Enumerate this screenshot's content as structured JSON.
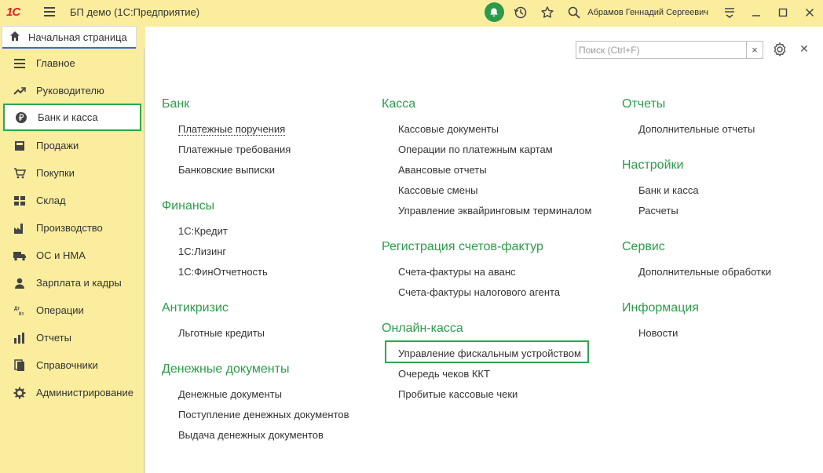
{
  "app": {
    "logo_text": "1С",
    "title": "БП демо  (1С:Предприятие)",
    "user_name": "Абрамов Геннадий Сергеевич"
  },
  "home_tab": {
    "label": "Начальная страница"
  },
  "sidebar": {
    "items": [
      {
        "label": "Главное",
        "icon": "list-icon"
      },
      {
        "label": "Руководителю",
        "icon": "trend-icon"
      },
      {
        "label": "Банк и касса",
        "icon": "ruble-icon"
      },
      {
        "label": "Продажи",
        "icon": "sales-icon"
      },
      {
        "label": "Покупки",
        "icon": "cart-icon"
      },
      {
        "label": "Склад",
        "icon": "warehouse-icon"
      },
      {
        "label": "Производство",
        "icon": "factory-icon"
      },
      {
        "label": "ОС и НМА",
        "icon": "truck-icon"
      },
      {
        "label": "Зарплата и кадры",
        "icon": "person-icon"
      },
      {
        "label": "Операции",
        "icon": "dt-kt-icon"
      },
      {
        "label": "Отчеты",
        "icon": "bar-chart-icon"
      },
      {
        "label": "Справочники",
        "icon": "books-icon"
      },
      {
        "label": "Администрирование",
        "icon": "gear-icon"
      }
    ]
  },
  "search": {
    "placeholder": "Поиск (Ctrl+F)",
    "value": ""
  },
  "sections": {
    "bank": {
      "title": "Банк",
      "links": [
        "Платежные поручения",
        "Платежные требования",
        "Банковские выписки"
      ]
    },
    "finance": {
      "title": "Финансы",
      "links": [
        "1С:Кредит",
        "1С:Лизинг",
        "1С:ФинОтчетность"
      ]
    },
    "anticrisis": {
      "title": "Антикризис",
      "links": [
        "Льготные кредиты"
      ]
    },
    "money_docs": {
      "title": "Денежные документы",
      "links": [
        "Денежные документы",
        "Поступление денежных документов",
        "Выдача денежных документов"
      ]
    },
    "kassa": {
      "title": "Касса",
      "links": [
        "Кассовые документы",
        "Операции по платежным картам",
        "Авансовые отчеты",
        "Кассовые смены",
        "Управление эквайринговым терминалом"
      ]
    },
    "invoices": {
      "title": "Регистрация счетов-фактур",
      "links": [
        "Счета-фактуры на аванс",
        "Счета-фактуры налогового агента"
      ]
    },
    "online_kassa": {
      "title": "Онлайн-касса",
      "links": [
        "Управление фискальным устройством",
        "Очередь чеков ККТ",
        "Пробитые кассовые чеки"
      ]
    },
    "reports": {
      "title": "Отчеты",
      "links": [
        "Дополнительные отчеты"
      ]
    },
    "settings": {
      "title": "Настройки",
      "links": [
        "Банк и касса",
        "Расчеты"
      ]
    },
    "service": {
      "title": "Сервис",
      "links": [
        "Дополнительные обработки"
      ]
    },
    "info": {
      "title": "Информация",
      "links": [
        "Новости"
      ]
    }
  },
  "colors": {
    "accent_green": "#2a9e48",
    "sidebar_bg": "#fbed9e",
    "highlight_border": "#2ba84a"
  }
}
